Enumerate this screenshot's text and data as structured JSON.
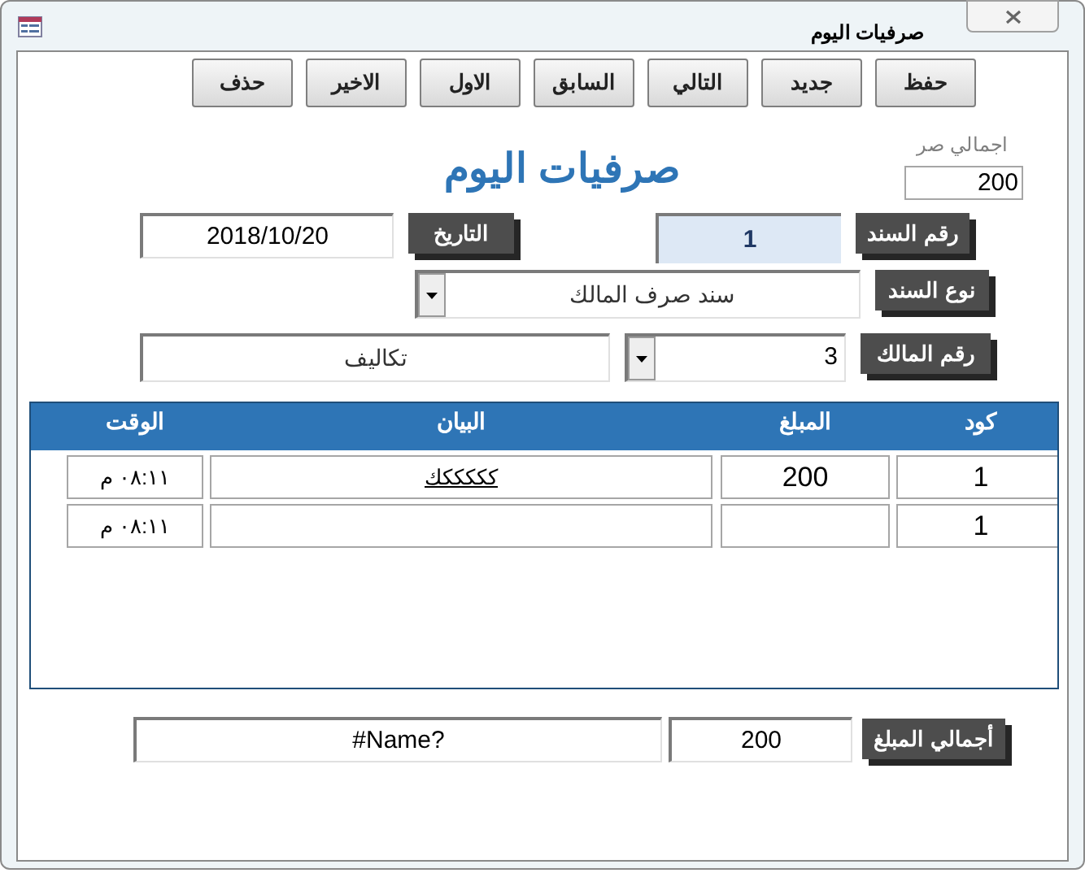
{
  "window": {
    "title": "صرفيات اليوم"
  },
  "toolbar": {
    "buttons": [
      "حفظ",
      "جديد",
      "التالي",
      "السابق",
      "الاول",
      "الاخير",
      "حذف"
    ]
  },
  "total_today": {
    "label": "اجمالي صر",
    "value": "200"
  },
  "heading": "صرفيات اليوم",
  "voucher_number": {
    "label": "رقم السند",
    "value": "1"
  },
  "date": {
    "label": "التاريخ",
    "value": "2018/10/20"
  },
  "voucher_type": {
    "label": "نوع السند",
    "value": "سند صرف المالك"
  },
  "owner_number": {
    "label": "رقم المالك",
    "value": "3",
    "owner_name": "تكاليف"
  },
  "table": {
    "columns": [
      "كود",
      "المبلغ",
      "البيان",
      "الوقت"
    ],
    "rows": [
      {
        "code": "1",
        "amount": "200",
        "description": "كككككك",
        "time": "٠٨:١١ م"
      },
      {
        "code": "1",
        "time": "٠٨:١١ م"
      }
    ]
  },
  "footer": {
    "label": "أجمالي المبلغ",
    "total": "200",
    "value_2": "#Name?"
  }
}
